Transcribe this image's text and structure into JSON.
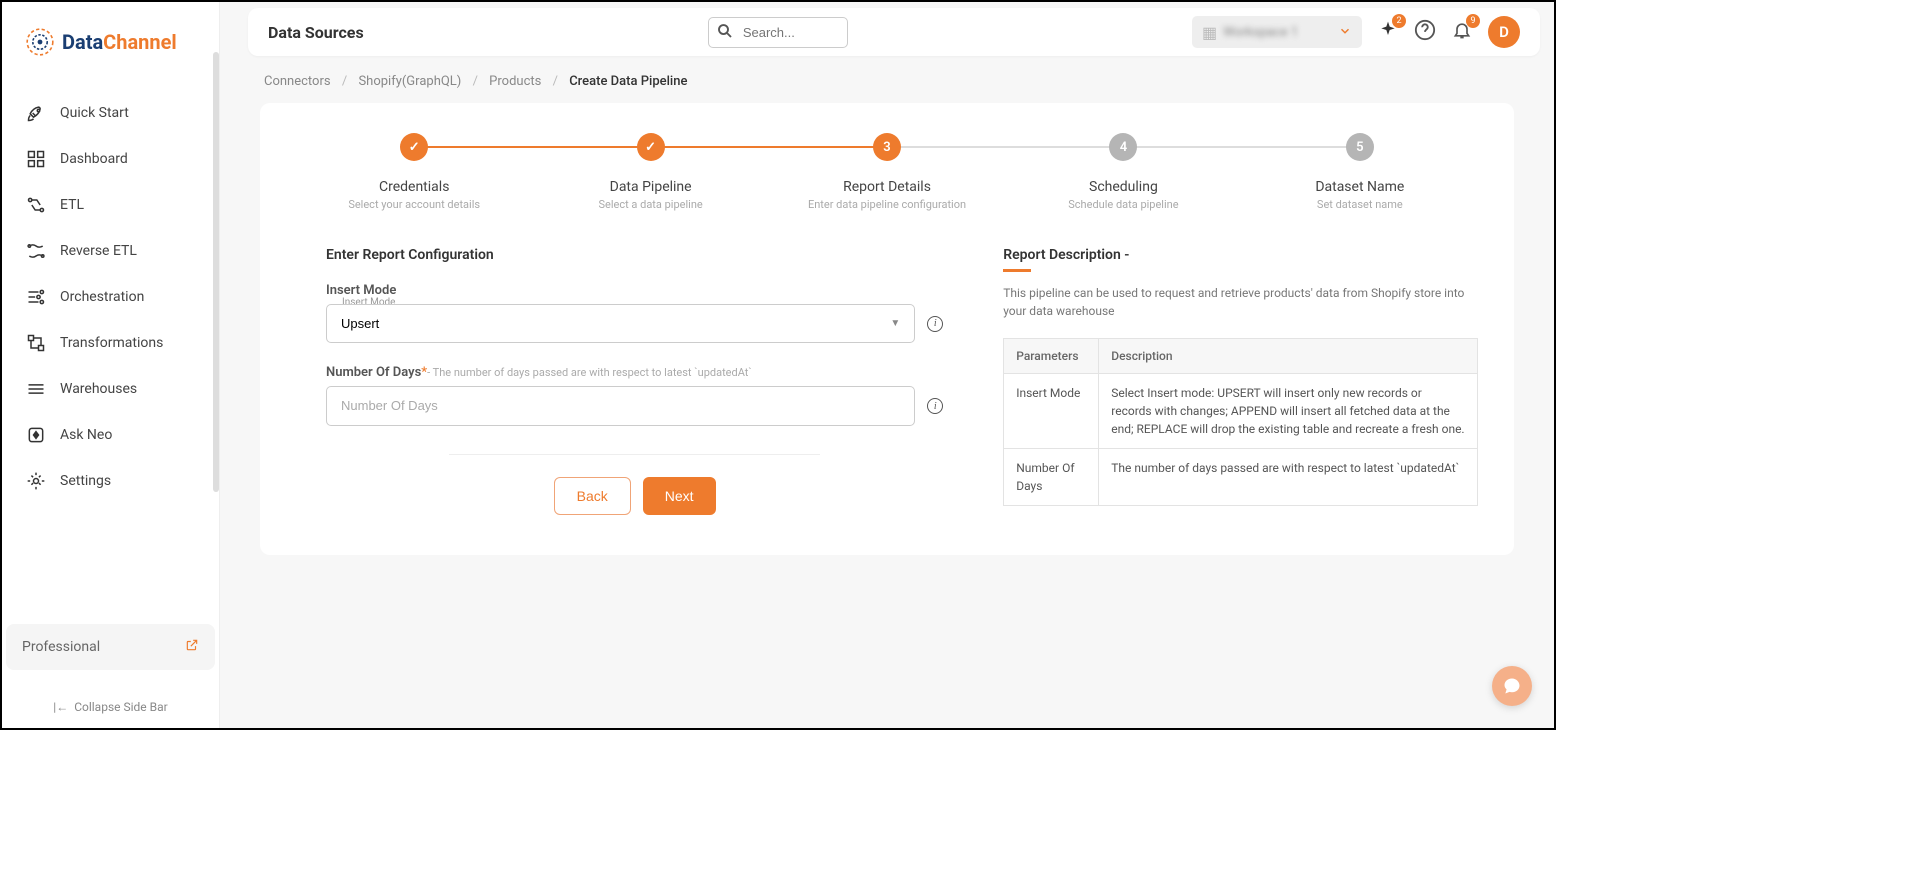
{
  "logo": {
    "part1": "Data",
    "part2": "Channel"
  },
  "sidebar": {
    "items": [
      {
        "label": "Quick Start"
      },
      {
        "label": "Dashboard"
      },
      {
        "label": "ETL"
      },
      {
        "label": "Reverse ETL"
      },
      {
        "label": "Orchestration"
      },
      {
        "label": "Transformations"
      },
      {
        "label": "Warehouses"
      },
      {
        "label": "Ask Neo"
      },
      {
        "label": "Settings"
      }
    ],
    "plan": "Professional",
    "collapse": "Collapse Side Bar"
  },
  "topbar": {
    "title": "Data Sources",
    "search_placeholder": "Search...",
    "workspace": "Workspace 1",
    "sparkle_badge": "2",
    "bell_badge": "9",
    "avatar": "D"
  },
  "breadcrumb": [
    "Connectors",
    "Shopify(GraphQL)",
    "Products",
    "Create Data Pipeline"
  ],
  "stepper": [
    {
      "title": "Credentials",
      "sub": "Select your account details",
      "state": "done",
      "mark": "✓"
    },
    {
      "title": "Data Pipeline",
      "sub": "Select a data pipeline",
      "state": "done",
      "mark": "✓"
    },
    {
      "title": "Report Details",
      "sub": "Enter data pipeline configuration",
      "state": "active",
      "mark": "3"
    },
    {
      "title": "Scheduling",
      "sub": "Schedule data pipeline",
      "state": "pending",
      "mark": "4"
    },
    {
      "title": "Dataset Name",
      "sub": "Set dataset name",
      "state": "pending",
      "mark": "5"
    }
  ],
  "form": {
    "section_heading": "Enter Report Configuration",
    "insert_mode": {
      "label": "Insert Mode",
      "float_label": "Insert Mode",
      "value": "Upsert"
    },
    "num_days": {
      "label": "Number Of Days",
      "hint": "- The number of days passed are with respect to latest `updatedAt`",
      "placeholder": "Number Of Days",
      "value": ""
    },
    "buttons": {
      "back": "Back",
      "next": "Next"
    }
  },
  "description": {
    "heading": "Report Description -",
    "text": "This pipeline can be used to request and retrieve products' data from Shopify store into your data warehouse",
    "table": {
      "headers": [
        "Parameters",
        "Description"
      ],
      "rows": [
        [
          "Insert Mode",
          "Select Insert mode: UPSERT will insert only new records or records with changes; APPEND will insert all fetched data at the end; REPLACE will drop the existing table and recreate a fresh one."
        ],
        [
          "Number Of Days",
          "The number of days passed are with respect to latest `updatedAt`"
        ]
      ]
    }
  }
}
